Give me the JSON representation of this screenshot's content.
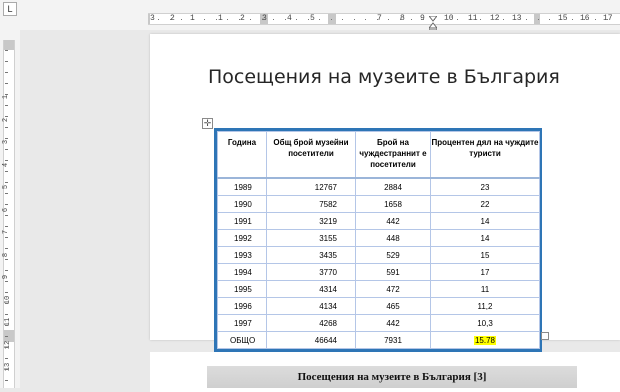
{
  "ruler": {
    "corner_label": "L",
    "horizontal_numbers": [
      "3",
      "2",
      "1",
      "1",
      "2",
      "3",
      "4",
      "5",
      "7",
      "8",
      "9",
      "10",
      "11",
      "12",
      "13",
      "15",
      "16",
      "17"
    ],
    "vertical_numbers": [
      "1",
      "2",
      "3",
      "4",
      "5",
      "6",
      "7",
      "8",
      "9",
      "10",
      "11",
      "12",
      "13"
    ]
  },
  "document": {
    "title": "Посещения на музеите в България",
    "table": {
      "headers": [
        "Година",
        "Общ брой музейни посетители",
        "Брой на чуждестраннит е посетители",
        "Процентен дял на чуждите туристи"
      ],
      "rows": [
        [
          "1989",
          "12767",
          "2884",
          "23"
        ],
        [
          "1990",
          "7582",
          "1658",
          "22"
        ],
        [
          "1991",
          "3219",
          "442",
          "14"
        ],
        [
          "1992",
          "3155",
          "448",
          "14"
        ],
        [
          "1993",
          "3435",
          "529",
          "15"
        ],
        [
          "1994",
          "3770",
          "591",
          "17"
        ],
        [
          "1995",
          "4314",
          "472",
          "11"
        ],
        [
          "1996",
          "4134",
          "465",
          "11,2"
        ],
        [
          "1997",
          "4268",
          "442",
          "10,3"
        ]
      ],
      "total_row": [
        "ОБЩО",
        "46644",
        "7931",
        "15.78"
      ],
      "highlight_color": "#ffff00",
      "border_color": "#2e75b6"
    },
    "next_page_title": "Посещения на музеите в България [3]"
  },
  "icons": {
    "move_handle": "move-icon",
    "resize_handle": "resize-icon",
    "indent_marker": "indent-marker-icon"
  }
}
